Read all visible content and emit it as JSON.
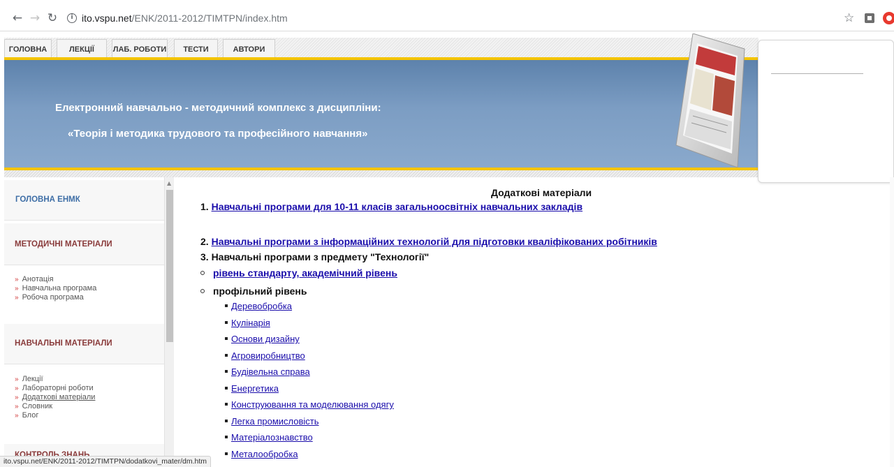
{
  "browser": {
    "url_host": "ito.vspu.net",
    "url_path": "/ENK/2011-2012/TIMTPN/index.htm"
  },
  "nav": {
    "tabs": [
      "ГОЛОВНА",
      "ЛЕКЦІЇ",
      "ЛАБ. РОБОТИ",
      "ТЕСТИ",
      "АВТОРИ"
    ]
  },
  "banner": {
    "line1": "Електронний навчально - методичний комплекс з дисципліни:",
    "line2": "«Теорія і методика трудового та професійного навчання»"
  },
  "sidebar": {
    "home": "ГОЛОВНА ЕНМК",
    "methodical": "МЕТОДИЧНІ МАТЕРІАЛИ",
    "methodical_links": [
      "Анотація",
      "Навчальна програма",
      "Робоча програма"
    ],
    "learning": "НАВЧАЛЬНІ МАТЕРІАЛИ",
    "learning_links": [
      "Лекції",
      "Лабораторні роботи",
      "Додаткові матеріали",
      "Словник",
      "Блог"
    ],
    "control": "КОНТРОЛЬ ЗНАНЬ"
  },
  "content": {
    "title": "Додаткові матеріали",
    "item1_num": "1.",
    "item1_link": "Навчальні програми для 10-11 класів загальноосвітніх навчальних закладів",
    "item2_num": "2.",
    "item2_link": "Навчальні програми з інформаційних технологій для підготовки кваліфікованих робітників",
    "item3": "3. Навчальні програми з предмету \"Технології\"",
    "level_standard": "рівень стандарту, академічний рівень",
    "level_profile": "профільний рівень",
    "profile_items": [
      "Деревобробка",
      "Кулінарія",
      "Основи дизайну",
      "Агровиробництво",
      "Будівельна справа",
      "Енергетика",
      "Конструювання та моделювання одягу",
      "Легка промисловість",
      "Матеріалознавство",
      "Металообробка"
    ]
  },
  "status": {
    "text": "ito.vspu.net/ENK/2011-2012/TIMTPN/dodatkovi_mater/dm.htm"
  }
}
